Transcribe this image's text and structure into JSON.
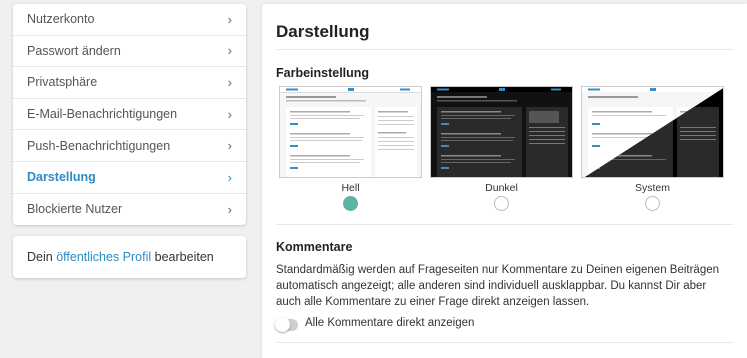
{
  "sidebar": {
    "items": [
      {
        "label": "Nutzerkonto"
      },
      {
        "label": "Passwort ändern"
      },
      {
        "label": "Privatsphäre"
      },
      {
        "label": "E-Mail-Benachrichtigungen"
      },
      {
        "label": "Push-Benachrichtigungen"
      },
      {
        "label": "Darstellung",
        "active": true
      },
      {
        "label": "Blockierte Nutzer"
      }
    ],
    "chevron": "›",
    "profile": {
      "prefix": "Dein",
      "link": "öffentliches Profil",
      "suffix": "bearbeiten"
    }
  },
  "main": {
    "title": "Darstellung",
    "color_setting": {
      "heading": "Farbeinstellung",
      "options": [
        {
          "label": "Hell",
          "selected": true
        },
        {
          "label": "Dunkel",
          "selected": false
        },
        {
          "label": "System",
          "selected": false
        }
      ]
    },
    "comments": {
      "heading": "Kommentare",
      "description": "Standardmäßig werden auf Frageseiten nur Kommentare zu Deinen eigenen Beiträgen automatisch angezeigt; alle anderen sind individuell ausklappbar. Du kannst Dir aber auch alle Kommentare zu einer Frage direkt anzeigen lassen.",
      "toggle_label": "Alle Kommentare direkt anzeigen",
      "toggle_on": false
    }
  },
  "colors": {
    "accent": "#2f8bc3",
    "radio_selected": "#5fb3a5"
  }
}
